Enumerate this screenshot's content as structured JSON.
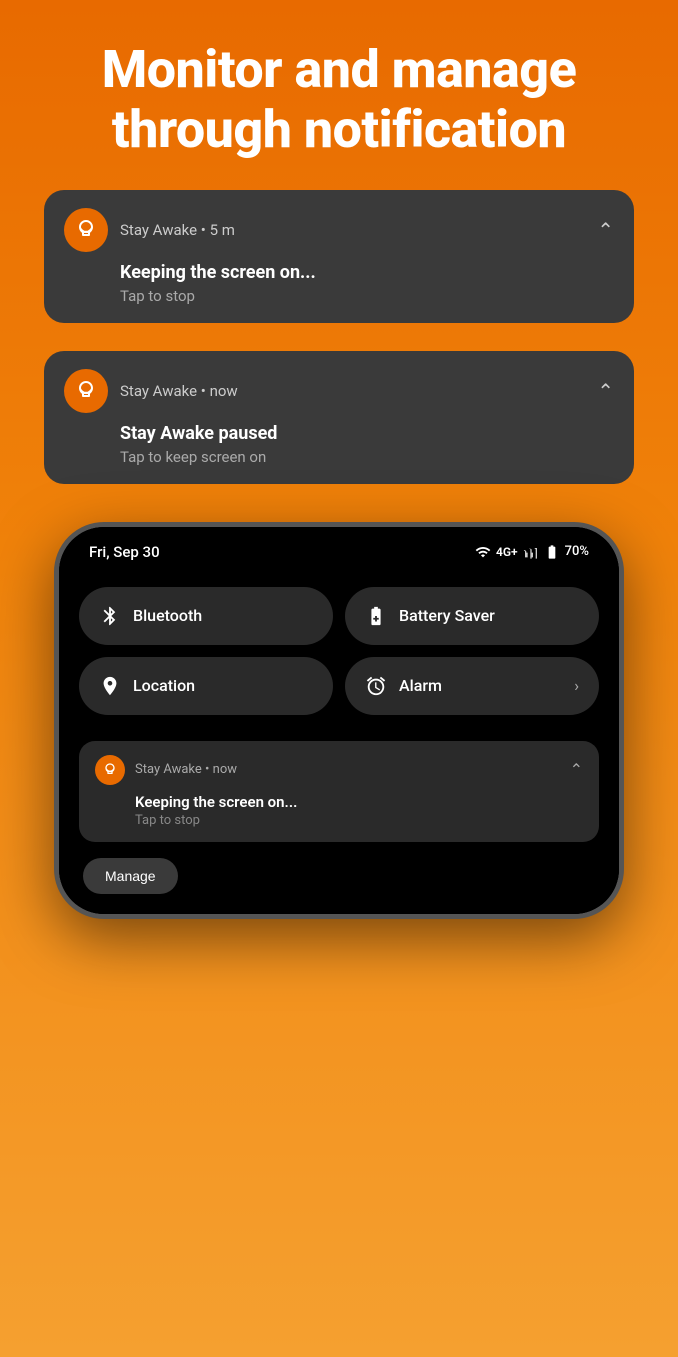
{
  "hero": {
    "title": "Monitor and manage through notification"
  },
  "notification_card_1": {
    "app_name": "Stay Awake",
    "time": "5 m",
    "title": "Keeping the screen on...",
    "subtitle": "Tap to stop"
  },
  "notification_card_2": {
    "app_name": "Stay Awake",
    "time": "now",
    "title": "Stay Awake paused",
    "subtitle": "Tap to keep screen on"
  },
  "phone": {
    "status_bar": {
      "date": "Fri, Sep 30",
      "battery": "70%",
      "signal_label": "4G+"
    },
    "quick_tiles": [
      {
        "icon": "bluetooth",
        "label": "Bluetooth",
        "has_arrow": false
      },
      {
        "icon": "battery_saver",
        "label": "Battery Saver",
        "has_arrow": false
      },
      {
        "icon": "location",
        "label": "Location",
        "has_arrow": false
      },
      {
        "icon": "alarm",
        "label": "Alarm",
        "has_arrow": true
      }
    ],
    "notification": {
      "app_name": "Stay Awake",
      "time": "now",
      "title": "Keeping the screen on...",
      "subtitle": "Tap to stop"
    },
    "manage_btn": "Manage"
  }
}
